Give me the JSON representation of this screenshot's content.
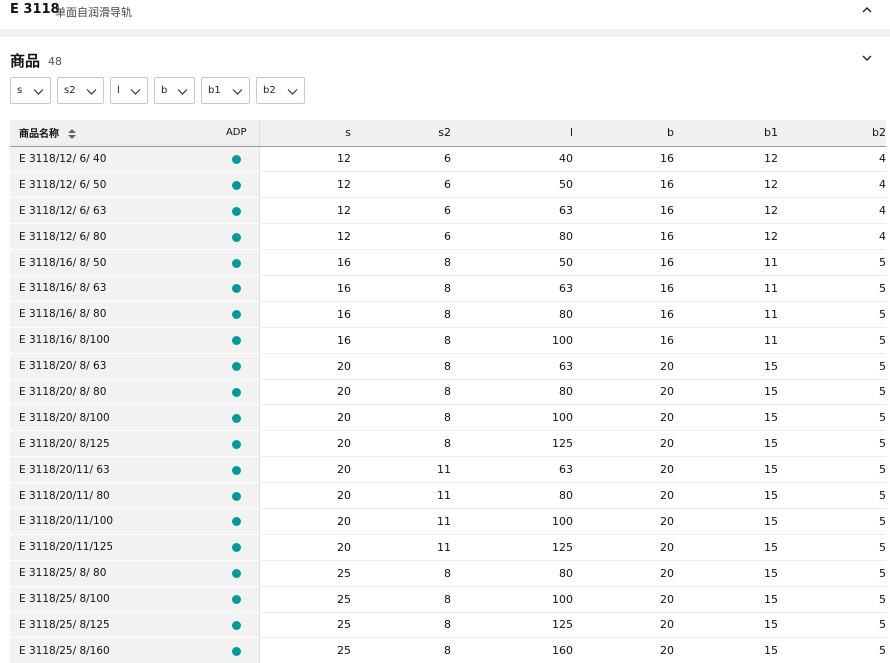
{
  "product": {
    "code": "E 3118",
    "subtitle": "单面自润滑导轨"
  },
  "section": {
    "title": "商品",
    "count": "48"
  },
  "filters": [
    {
      "label": "s"
    },
    {
      "label": "s2"
    },
    {
      "label": "l"
    },
    {
      "label": "b"
    },
    {
      "label": "b1"
    },
    {
      "label": "b2"
    }
  ],
  "table": {
    "headers": {
      "name": "商品名称",
      "adp": "ADP",
      "s": "s",
      "s2": "s2",
      "l": "l",
      "b": "b",
      "b1": "b1",
      "b2": "b2"
    },
    "adp_color": "#009b96",
    "rows": [
      {
        "name": "E 3118/12/ 6/ 40",
        "s": "12",
        "s2": "6",
        "l": "40",
        "b": "16",
        "b1": "12",
        "b2": "4"
      },
      {
        "name": "E 3118/12/ 6/ 50",
        "s": "12",
        "s2": "6",
        "l": "50",
        "b": "16",
        "b1": "12",
        "b2": "4"
      },
      {
        "name": "E 3118/12/ 6/ 63",
        "s": "12",
        "s2": "6",
        "l": "63",
        "b": "16",
        "b1": "12",
        "b2": "4"
      },
      {
        "name": "E 3118/12/ 6/ 80",
        "s": "12",
        "s2": "6",
        "l": "80",
        "b": "16",
        "b1": "12",
        "b2": "4"
      },
      {
        "name": "E 3118/16/ 8/ 50",
        "s": "16",
        "s2": "8",
        "l": "50",
        "b": "16",
        "b1": "11",
        "b2": "5"
      },
      {
        "name": "E 3118/16/ 8/ 63",
        "s": "16",
        "s2": "8",
        "l": "63",
        "b": "16",
        "b1": "11",
        "b2": "5"
      },
      {
        "name": "E 3118/16/ 8/ 80",
        "s": "16",
        "s2": "8",
        "l": "80",
        "b": "16",
        "b1": "11",
        "b2": "5"
      },
      {
        "name": "E 3118/16/ 8/100",
        "s": "16",
        "s2": "8",
        "l": "100",
        "b": "16",
        "b1": "11",
        "b2": "5"
      },
      {
        "name": "E 3118/20/ 8/ 63",
        "s": "20",
        "s2": "8",
        "l": "63",
        "b": "20",
        "b1": "15",
        "b2": "5"
      },
      {
        "name": "E 3118/20/ 8/ 80",
        "s": "20",
        "s2": "8",
        "l": "80",
        "b": "20",
        "b1": "15",
        "b2": "5"
      },
      {
        "name": "E 3118/20/ 8/100",
        "s": "20",
        "s2": "8",
        "l": "100",
        "b": "20",
        "b1": "15",
        "b2": "5"
      },
      {
        "name": "E 3118/20/ 8/125",
        "s": "20",
        "s2": "8",
        "l": "125",
        "b": "20",
        "b1": "15",
        "b2": "5"
      },
      {
        "name": "E 3118/20/11/ 63",
        "s": "20",
        "s2": "11",
        "l": "63",
        "b": "20",
        "b1": "15",
        "b2": "5"
      },
      {
        "name": "E 3118/20/11/ 80",
        "s": "20",
        "s2": "11",
        "l": "80",
        "b": "20",
        "b1": "15",
        "b2": "5"
      },
      {
        "name": "E 3118/20/11/100",
        "s": "20",
        "s2": "11",
        "l": "100",
        "b": "20",
        "b1": "15",
        "b2": "5"
      },
      {
        "name": "E 3118/20/11/125",
        "s": "20",
        "s2": "11",
        "l": "125",
        "b": "20",
        "b1": "15",
        "b2": "5"
      },
      {
        "name": "E 3118/25/ 8/ 80",
        "s": "25",
        "s2": "8",
        "l": "80",
        "b": "20",
        "b1": "15",
        "b2": "5"
      },
      {
        "name": "E 3118/25/ 8/100",
        "s": "25",
        "s2": "8",
        "l": "100",
        "b": "20",
        "b1": "15",
        "b2": "5"
      },
      {
        "name": "E 3118/25/ 8/125",
        "s": "25",
        "s2": "8",
        "l": "125",
        "b": "20",
        "b1": "15",
        "b2": "5"
      },
      {
        "name": "E 3118/25/ 8/160",
        "s": "25",
        "s2": "8",
        "l": "160",
        "b": "20",
        "b1": "15",
        "b2": "5"
      }
    ]
  }
}
